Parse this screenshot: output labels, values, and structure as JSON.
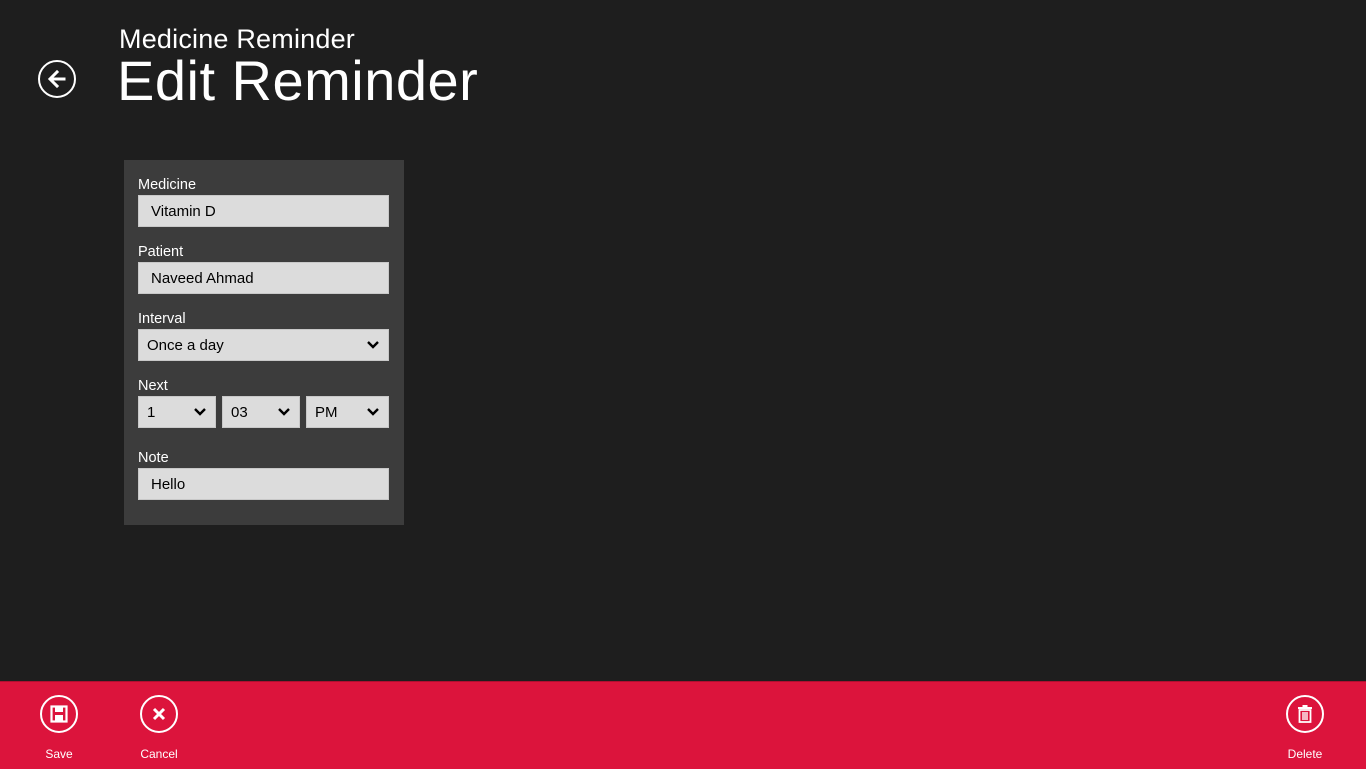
{
  "header": {
    "app_title": "Medicine Reminder",
    "page_title": "Edit Reminder"
  },
  "form": {
    "medicine_label": "Medicine",
    "medicine_value": "Vitamin D",
    "patient_label": "Patient",
    "patient_value": "Naveed Ahmad",
    "interval_label": "Interval",
    "interval_value": "Once a day",
    "next_label": "Next",
    "next_hour": "1",
    "next_minute": "03",
    "next_ampm": "PM",
    "note_label": "Note",
    "note_value": "Hello"
  },
  "appbar": {
    "save_label": "Save",
    "cancel_label": "Cancel",
    "delete_label": "Delete",
    "color": "#dc143c"
  },
  "icons": {
    "back": "back-arrow-icon",
    "save": "save-icon",
    "cancel": "cancel-icon",
    "delete": "trash-icon",
    "dropdown": "chevron-down-icon"
  }
}
